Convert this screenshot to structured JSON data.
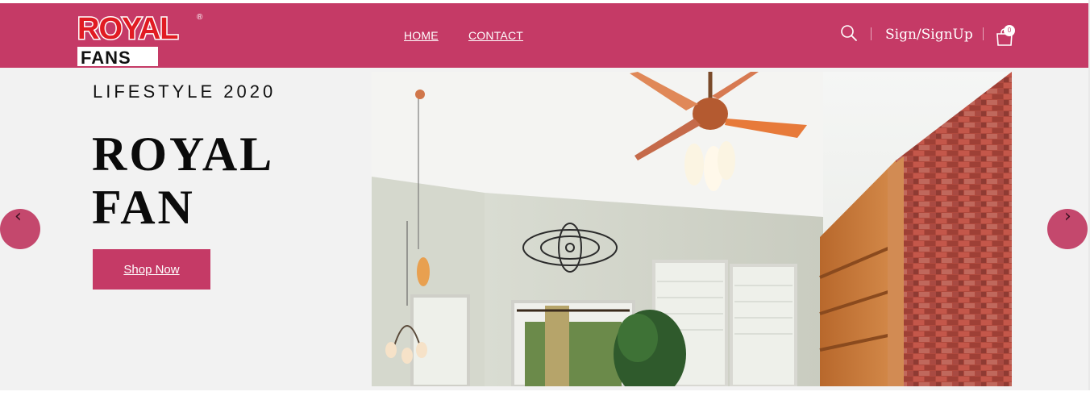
{
  "brand": {
    "logo_top": "ROYAL",
    "logo_bottom": "FANS",
    "registered": "®"
  },
  "nav": {
    "home": "HOME",
    "contact": "CONTACT"
  },
  "header_actions": {
    "search_icon": "search-icon",
    "account": "Sign/SignUp",
    "cart_icon": "shopping-bag-icon",
    "cart_count": "0"
  },
  "hero": {
    "eyebrow": "LIFESTYLE 2020",
    "title_line1": "ROYAL",
    "title_line2": "FAN",
    "cta": "Shop Now",
    "prev_symbol": "‹",
    "next_symbol": "›"
  },
  "colors": {
    "brand": "#c53a66",
    "hero_bg": "#f2f2f2",
    "text_dark": "#0b0b0b"
  }
}
